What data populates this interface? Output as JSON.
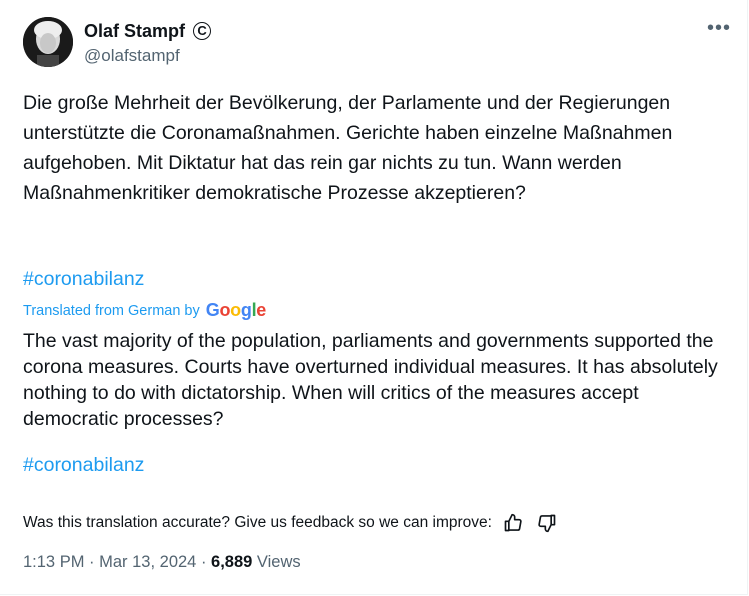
{
  "author": {
    "display_name": "Olaf Stampf",
    "badge_glyph": "C",
    "handle": "@olafstampf"
  },
  "more_label": "•••",
  "original_text": "Die große Mehrheit der Bevölkerung, der Parlamente und der Regierungen unterstützte die Coronamaßnahmen. Gerichte haben einzelne Maßnahmen aufgehoben. Mit Diktatur hat das rein gar nichts zu tun. Wann werden Maßnahmenkritiker demokratische Prozesse akzeptieren?",
  "hashtag": "#coronabilanz",
  "translation": {
    "label": "Translated from German by",
    "google": [
      "G",
      "o",
      "o",
      "g",
      "l",
      "e"
    ],
    "text": "The vast majority of the population, parliaments and governments supported the corona measures. Courts have overturned individual measures. It has absolutely nothing to do with dictatorship. When will critics of the measures accept democratic processes?",
    "hashtag": "#coronabilanz"
  },
  "feedback": {
    "question": "Was this translation accurate? Give us feedback so we can improve:",
    "up_icon": "thumbs-up-icon",
    "down_icon": "thumbs-down-icon"
  },
  "meta": {
    "time": "1:13 PM",
    "sep1": " · ",
    "date": "Mar 13, 2024",
    "sep2": " · ",
    "views_count": "6,889",
    "views_label": " Views"
  },
  "colors": {
    "link": "#1d9bf0",
    "secondary": "#536471",
    "text": "#0f1419"
  }
}
